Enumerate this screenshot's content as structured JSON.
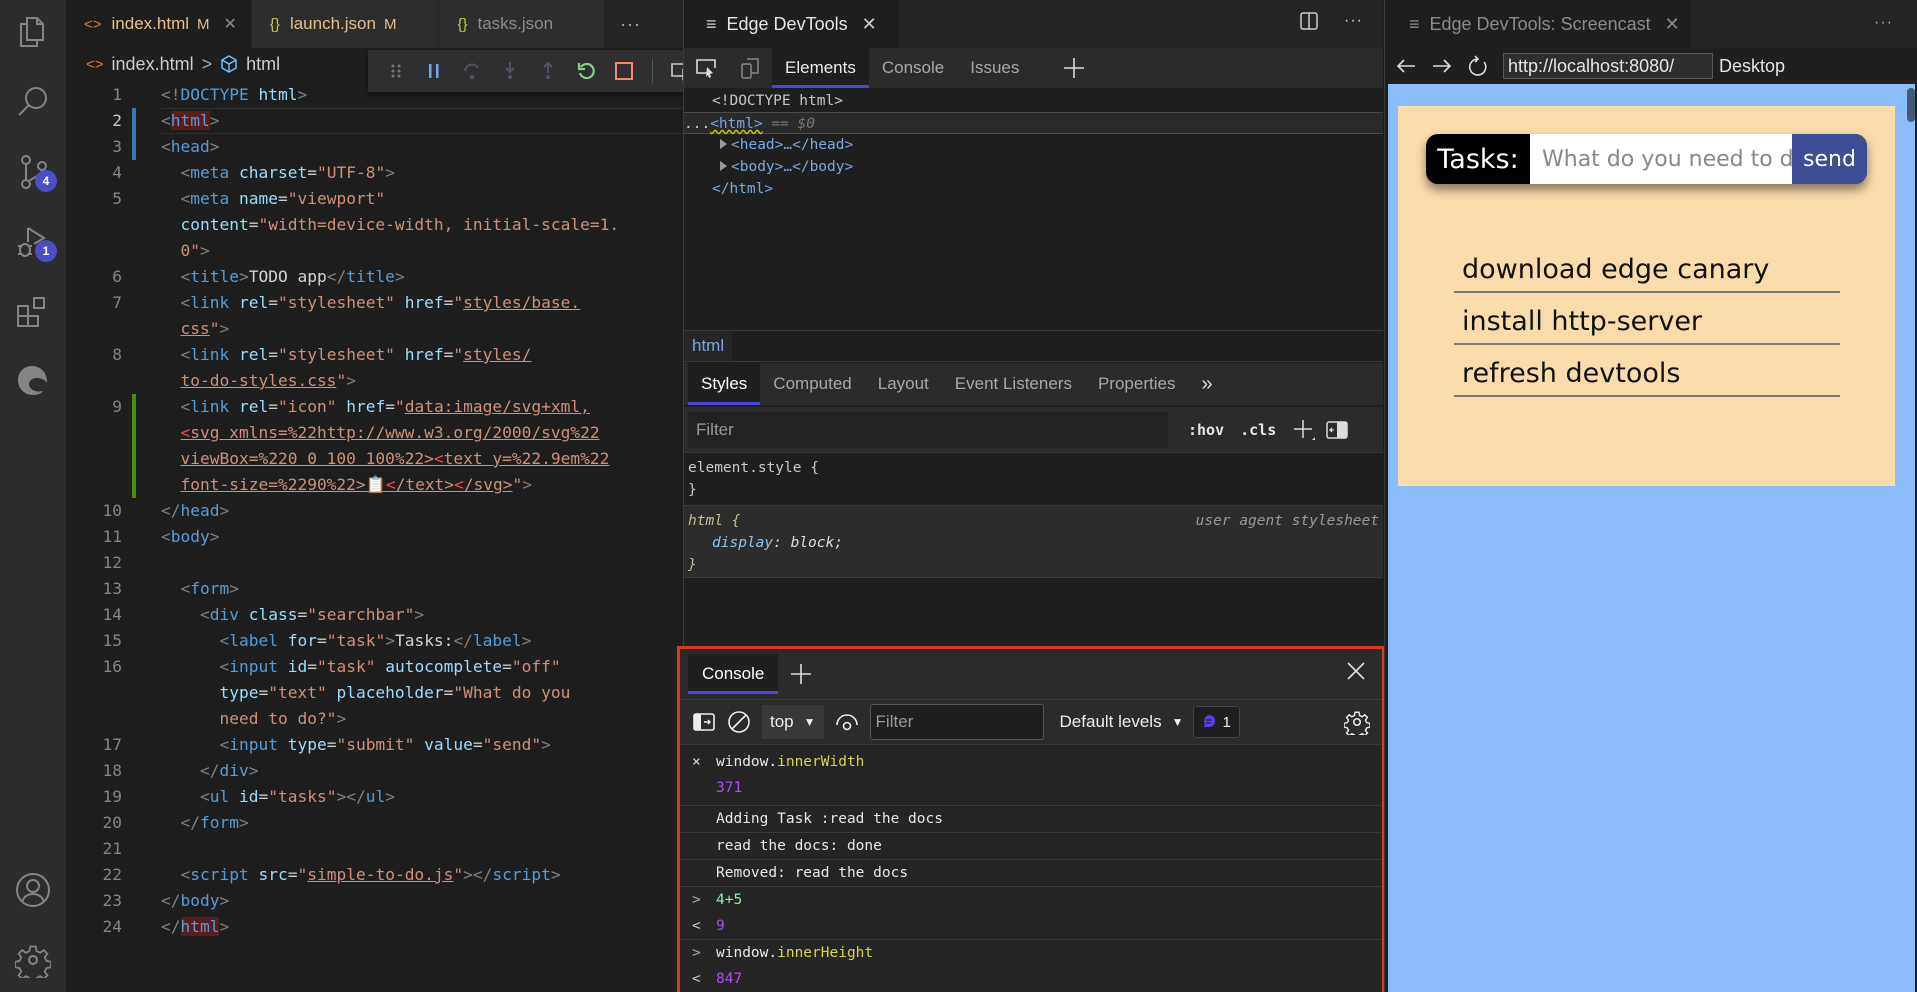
{
  "activity_bar": {
    "items": [
      {
        "name": "explorer",
        "icon": "files-icon"
      },
      {
        "name": "search",
        "icon": "search-icon"
      },
      {
        "name": "source-control",
        "icon": "source-control-icon",
        "badge": "4"
      },
      {
        "name": "run-debug",
        "icon": "run-debug-icon",
        "badge": "1"
      },
      {
        "name": "extensions",
        "icon": "extensions-icon"
      },
      {
        "name": "edge-devtools",
        "icon": "edge-icon"
      }
    ],
    "bottom": [
      {
        "name": "accounts",
        "icon": "account-icon"
      },
      {
        "name": "manage",
        "icon": "gear-icon"
      }
    ]
  },
  "editor": {
    "tabs": [
      {
        "label": "index.html",
        "status": "M",
        "active": true,
        "icon": "<>"
      },
      {
        "label": "launch.json",
        "status": "M",
        "active": false,
        "icon": "{}"
      },
      {
        "label": "tasks.json",
        "status": "",
        "active": false,
        "icon": "{}"
      }
    ],
    "more": "···",
    "breadcrumb": [
      "index.html",
      "html"
    ],
    "breadcrumb_sep": ">",
    "debug_toolbar": [
      "drag",
      "pause",
      "step-over",
      "step-into",
      "step-out",
      "restart",
      "stop",
      "inspect-screencast"
    ],
    "line_numbers": [
      "1",
      "2",
      "3",
      "4",
      "5",
      "",
      "",
      "6",
      "7",
      "",
      "8",
      "",
      "9",
      "",
      "",
      "",
      "10",
      "11",
      "12",
      "13",
      "14",
      "15",
      "16",
      "",
      "",
      "17",
      "18",
      "19",
      "20",
      "21",
      "22",
      "23",
      "24"
    ]
  },
  "devtools": {
    "tab_title": "Edge DevTools",
    "panel_tabs": [
      "Elements",
      "Console",
      "Issues"
    ],
    "active_panel": "Elements",
    "dom": {
      "doctype": "<!DOCTYPE html>",
      "html_open": "<html>",
      "selected_marker": "== $0",
      "head": "<head>…</head>",
      "body": "<body>…</body>",
      "html_close": "</html>"
    },
    "breadcrumb": "html",
    "styles_tabs": [
      "Styles",
      "Computed",
      "Layout",
      "Event Listeners",
      "Properties"
    ],
    "styles_more": "»",
    "styles_filter_placeholder": "Filter",
    "hov": ":hov",
    "cls": ".cls",
    "rules": {
      "element_style_open": "element.style {",
      "close": "}",
      "html_selector": "html {",
      "source": "user agent stylesheet",
      "prop": "display",
      "value": "block;"
    }
  },
  "console_drawer": {
    "tab": "Console",
    "context": "top",
    "filter_placeholder": "Filter",
    "levels": "Default levels",
    "issues_count": "1",
    "messages": [
      {
        "kind": "input",
        "prefix": "×",
        "obj": "window.",
        "prop": "innerWidth"
      },
      {
        "kind": "result-plain",
        "value": "371"
      },
      {
        "kind": "log",
        "text": "Adding Task :read the docs"
      },
      {
        "kind": "log",
        "text": "read the docs: done"
      },
      {
        "kind": "log",
        "text": "Removed: read the docs"
      },
      {
        "kind": "input-green",
        "prefix": ">",
        "text": "4+5"
      },
      {
        "kind": "result",
        "prefix": "<",
        "value": "9"
      },
      {
        "kind": "input",
        "prefix": ">",
        "obj": "window.",
        "prop": "innerHeight"
      },
      {
        "kind": "result",
        "prefix": "<",
        "value": "847"
      }
    ]
  },
  "screencast": {
    "tab_title": "Edge DevTools: Screencast",
    "url": "http://localhost:8080/",
    "device": "Desktop",
    "app": {
      "label": "Tasks:",
      "placeholder": "What do you need to do",
      "send": "send",
      "tasks": [
        "download edge canary",
        "install http-server",
        "refresh devtools"
      ]
    }
  },
  "colors": {
    "accent": "#4a4ad8",
    "highlight_border": "#d93a1e",
    "viewport_bg": "#8bbcfc",
    "app_bg": "#fadcab",
    "send_bg": "#3d4e96"
  }
}
